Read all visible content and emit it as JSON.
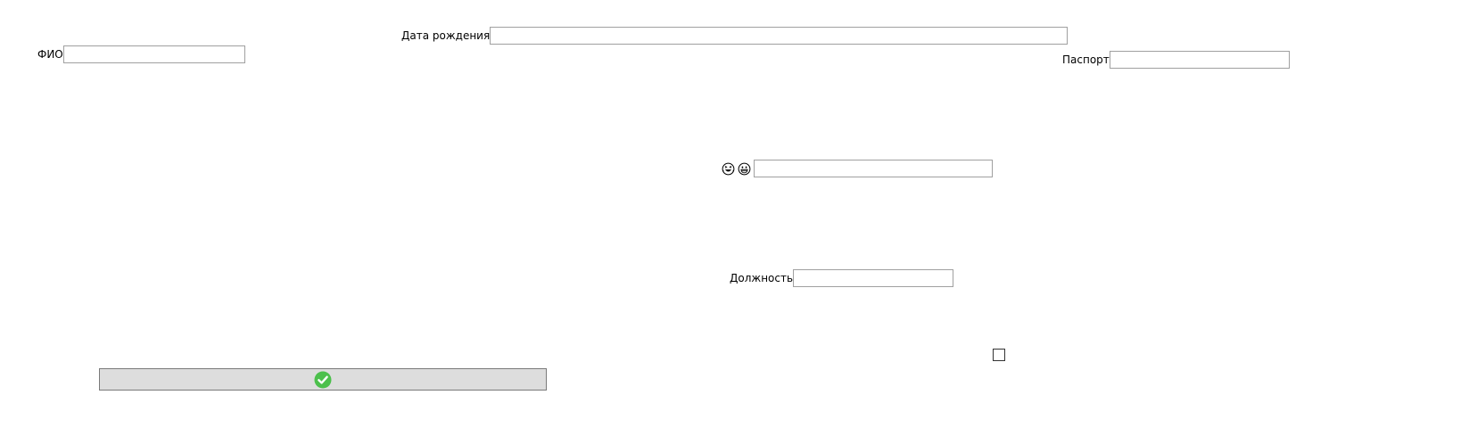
{
  "form": {
    "fio": {
      "label": "ФИО",
      "value": ""
    },
    "birth_date": {
      "label": "Дата рождения",
      "value": ""
    },
    "passport": {
      "label": "Паспорт",
      "value": ""
    },
    "emoji_field": {
      "icons": [
        "laughing-face-icon",
        "grinning-face-icon"
      ],
      "value": ""
    },
    "position": {
      "label": "Должность",
      "value": ""
    },
    "checkbox": {
      "checked": false
    },
    "submit": {
      "icon": "green-check-icon"
    }
  },
  "colors": {
    "input_border": "#a0a0a0",
    "button_background": "#dddddd",
    "button_border": "#7a7a7a",
    "check_icon": "#4cc04c"
  }
}
